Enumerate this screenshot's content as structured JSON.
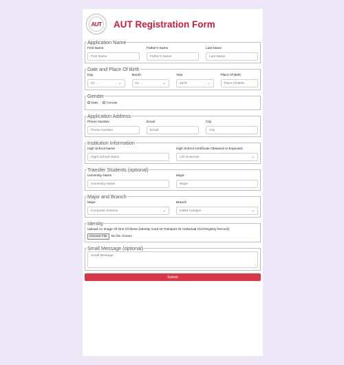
{
  "header": {
    "logo_text": "AUT",
    "title": "AUT Registration Form"
  },
  "sections": {
    "application_name": {
      "legend": "Application Name",
      "fields": [
        {
          "label": "First Name",
          "placeholder": "First Name"
        },
        {
          "label": "Father's Name",
          "placeholder": "Father's Name"
        },
        {
          "label": "Last Name",
          "placeholder": "Last Name"
        }
      ]
    },
    "birth": {
      "legend": "Date and Place Of Birth",
      "day_label": "Day",
      "day_value": "01",
      "month_label": "Month",
      "month_value": "01",
      "year_label": "Year",
      "year_value": "1970",
      "place_label": "Place Of Birth",
      "place_placeholder": "Place Of Birth"
    },
    "gender": {
      "legend": "Gender",
      "options": [
        "Male",
        "Female"
      ]
    },
    "address": {
      "legend": "Application Address",
      "fields": [
        {
          "label": "Phone Number",
          "placeholder": "Phone Number"
        },
        {
          "label": "Email",
          "placeholder": "Email"
        },
        {
          "label": "City",
          "placeholder": "City"
        }
      ]
    },
    "institution": {
      "legend": "Institution Information",
      "school_label": "High School Name",
      "school_placeholder": "Hight School Name",
      "cert_label": "High School Certificate Obtained or Expected",
      "cert_value": "Life Sciences"
    },
    "transfer": {
      "legend": "Transfer Students (optional)",
      "uni_label": "University Name",
      "uni_placeholder": "University Name",
      "major_label": "Major",
      "major_placeholder": "Major"
    },
    "major_branch": {
      "legend": "Major and Branch",
      "major_label": "Major",
      "major_value": "Computer Science",
      "branch_label": "Branch",
      "branch_value": "Hallat Campus"
    },
    "identity": {
      "legend": "Identity",
      "upload_label": "Upload An Image Of One Of these (Identity Card Or Passport Or Individual Civil Registry Record)",
      "button": "Choose File",
      "status": "No file chosen"
    },
    "message": {
      "legend": "Small Message (optional)",
      "placeholder": "Small Message"
    }
  },
  "submit": "Submit"
}
